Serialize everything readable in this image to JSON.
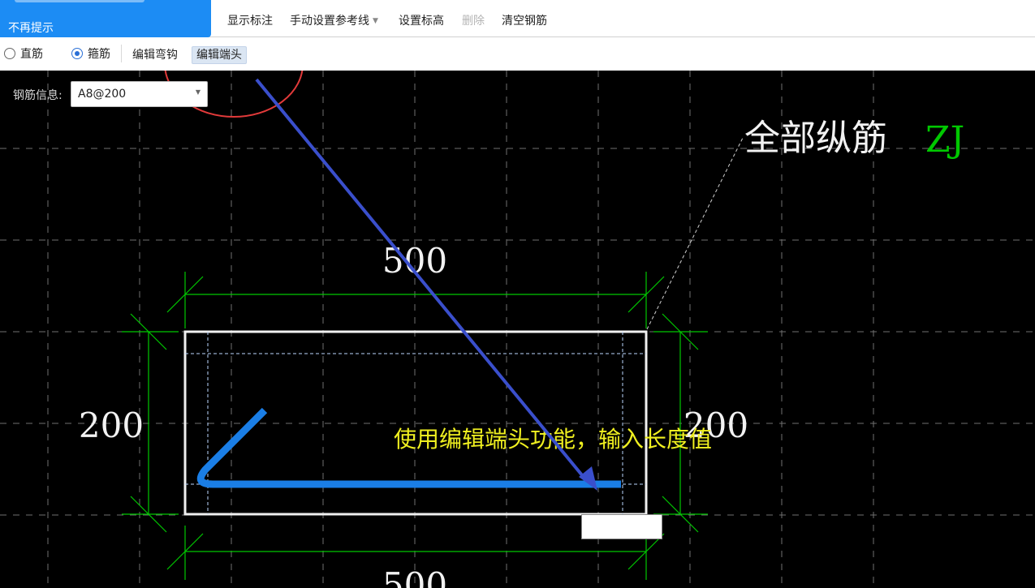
{
  "tip": {
    "text": "不再提示"
  },
  "toolbar": {
    "show_dims_label": "显示标注",
    "set_ref_line_label": "手动设置参考线",
    "set_elevation_label": "设置标高",
    "delete_label": "删除",
    "clear_rebar_label": "清空钢筋"
  },
  "toolbar2": {
    "straight_label": "直筋",
    "stirrup_label": "箍筋",
    "straight_checked": false,
    "stirrup_checked": true,
    "edit_hook_label": "编辑弯钩",
    "edit_end_label": "编辑端头"
  },
  "rebar_info": {
    "label": "钢筋信息:",
    "value": "A8@200"
  },
  "drawing": {
    "dim_top": "500",
    "dim_bottom": "500",
    "dim_left": "200",
    "dim_right": "200",
    "title": "全部纵筋",
    "code": "ZJ"
  },
  "annotation": {
    "text": "使用编辑端头功能，输入长度值"
  },
  "colors": {
    "rebar": "#1a7ee6",
    "dims": "#00c800",
    "arrow": "#3a4fcc",
    "circle": "#e23a3a",
    "annotation": "#f0f020"
  },
  "length_input": {
    "value": ""
  }
}
